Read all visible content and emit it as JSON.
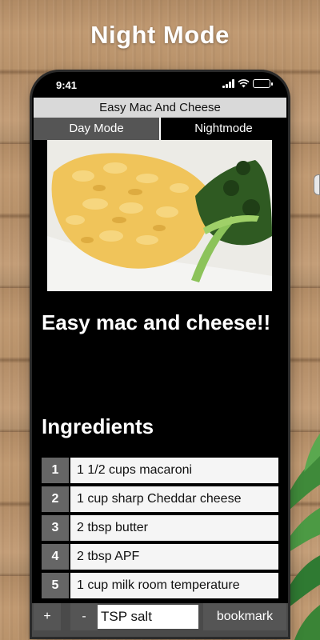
{
  "promo": {
    "headline": "Night Mode"
  },
  "status_bar": {
    "time": "9:41"
  },
  "app": {
    "title": "Easy Mac And Cheese"
  },
  "mode_tabs": [
    {
      "label": "Day Mode",
      "selected": false
    },
    {
      "label": "Nightmode",
      "selected": true
    }
  ],
  "recipe": {
    "title": "Easy mac and cheese!!",
    "ingredients_heading": "Ingredients",
    "ingredients": [
      {
        "num": "1",
        "text": "1 1/2 cups macaroni"
      },
      {
        "num": "2",
        "text": "1 cup sharp Cheddar cheese"
      },
      {
        "num": "3",
        "text": "2 tbsp butter"
      },
      {
        "num": "4",
        "text": "2 tbsp APF"
      },
      {
        "num": "5",
        "text": "1 cup milk room temperature"
      }
    ]
  },
  "bottom_bar": {
    "plus_label": "+",
    "minus_label": "-",
    "unit_value": "TSP salt",
    "bookmark_label": "bookmark"
  },
  "colors": {
    "night_bg": "#000000",
    "title_bar_bg": "#d9d9d9",
    "tab_inactive_bg": "#555555",
    "number_cell_bg": "#666666",
    "ingredient_cell_bg": "#f5f5f5"
  }
}
